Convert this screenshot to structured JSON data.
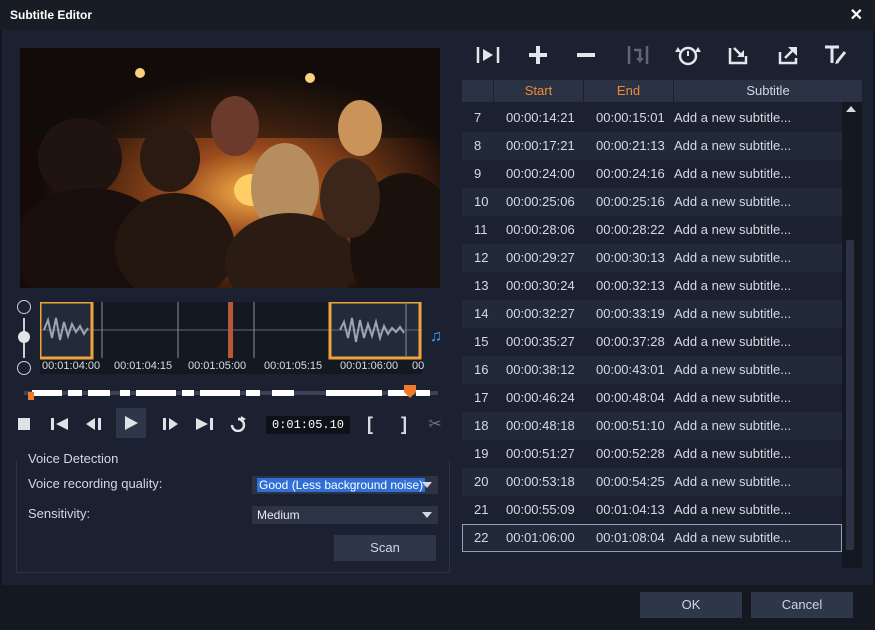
{
  "window": {
    "title": "Subtitle Editor",
    "close_icon": "close-icon"
  },
  "preview": {
    "description_icon": "video-preview"
  },
  "timeline": {
    "ticks": [
      "00:01:04:00",
      "00:01:04:15",
      "00:01:05:00",
      "00:01:05:15",
      "00:01:06:00",
      "00"
    ]
  },
  "playback": {
    "timecode": "0:01:05.10",
    "icons": [
      "stop-icon",
      "home-icon",
      "previous-frame-icon",
      "play-icon",
      "next-frame-icon",
      "end-icon",
      "repeat-icon",
      "mark-in-icon",
      "mark-out-icon",
      "split-icon"
    ]
  },
  "voice_detection": {
    "title": "Voice Detection",
    "quality_label": "Voice recording quality:",
    "quality_value": "Good (Less background noise)",
    "sensitivity_label": "Sensitivity:",
    "sensitivity_value": "Medium",
    "scan_label": "Scan"
  },
  "toolbar": {
    "icons": [
      "play-subtitle-icon",
      "add-subtitle-icon",
      "remove-subtitle-icon",
      "join-subtitle-icon",
      "time-offset-icon",
      "import-subtitle-icon",
      "export-subtitle-icon",
      "text-options-icon"
    ]
  },
  "table": {
    "headers": [
      "Start",
      "End",
      "Subtitle"
    ],
    "header_accent": "#f08a3c",
    "rows": [
      {
        "n": "7",
        "start": "00:00:14:21",
        "end": "00:00:15:01",
        "text": "Add a new subtitle..."
      },
      {
        "n": "8",
        "start": "00:00:17:21",
        "end": "00:00:21:13",
        "text": "Add a new subtitle..."
      },
      {
        "n": "9",
        "start": "00:00:24:00",
        "end": "00:00:24:16",
        "text": "Add a new subtitle..."
      },
      {
        "n": "10",
        "start": "00:00:25:06",
        "end": "00:00:25:16",
        "text": "Add a new subtitle..."
      },
      {
        "n": "11",
        "start": "00:00:28:06",
        "end": "00:00:28:22",
        "text": "Add a new subtitle..."
      },
      {
        "n": "12",
        "start": "00:00:29:27",
        "end": "00:00:30:13",
        "text": "Add a new subtitle..."
      },
      {
        "n": "13",
        "start": "00:00:30:24",
        "end": "00:00:32:13",
        "text": "Add a new subtitle..."
      },
      {
        "n": "14",
        "start": "00:00:32:27",
        "end": "00:00:33:19",
        "text": "Add a new subtitle..."
      },
      {
        "n": "15",
        "start": "00:00:35:27",
        "end": "00:00:37:28",
        "text": "Add a new subtitle..."
      },
      {
        "n": "16",
        "start": "00:00:38:12",
        "end": "00:00:43:01",
        "text": "Add a new subtitle..."
      },
      {
        "n": "17",
        "start": "00:00:46:24",
        "end": "00:00:48:04",
        "text": "Add a new subtitle..."
      },
      {
        "n": "18",
        "start": "00:00:48:18",
        "end": "00:00:51:10",
        "text": "Add a new subtitle..."
      },
      {
        "n": "19",
        "start": "00:00:51:27",
        "end": "00:00:52:28",
        "text": "Add a new subtitle..."
      },
      {
        "n": "20",
        "start": "00:00:53:18",
        "end": "00:00:54:25",
        "text": "Add a new subtitle..."
      },
      {
        "n": "21",
        "start": "00:00:55:09",
        "end": "00:01:04:13",
        "text": "Add a new subtitle..."
      },
      {
        "n": "22",
        "start": "00:01:06:00",
        "end": "00:01:08:04",
        "text": "Add a new subtitle..."
      }
    ],
    "selected_row": "22"
  },
  "footer": {
    "ok_label": "OK",
    "cancel_label": "Cancel"
  },
  "colors": {
    "accent": "#f08a3c",
    "selection": "#2f6fd6",
    "background": "#1b2130"
  }
}
